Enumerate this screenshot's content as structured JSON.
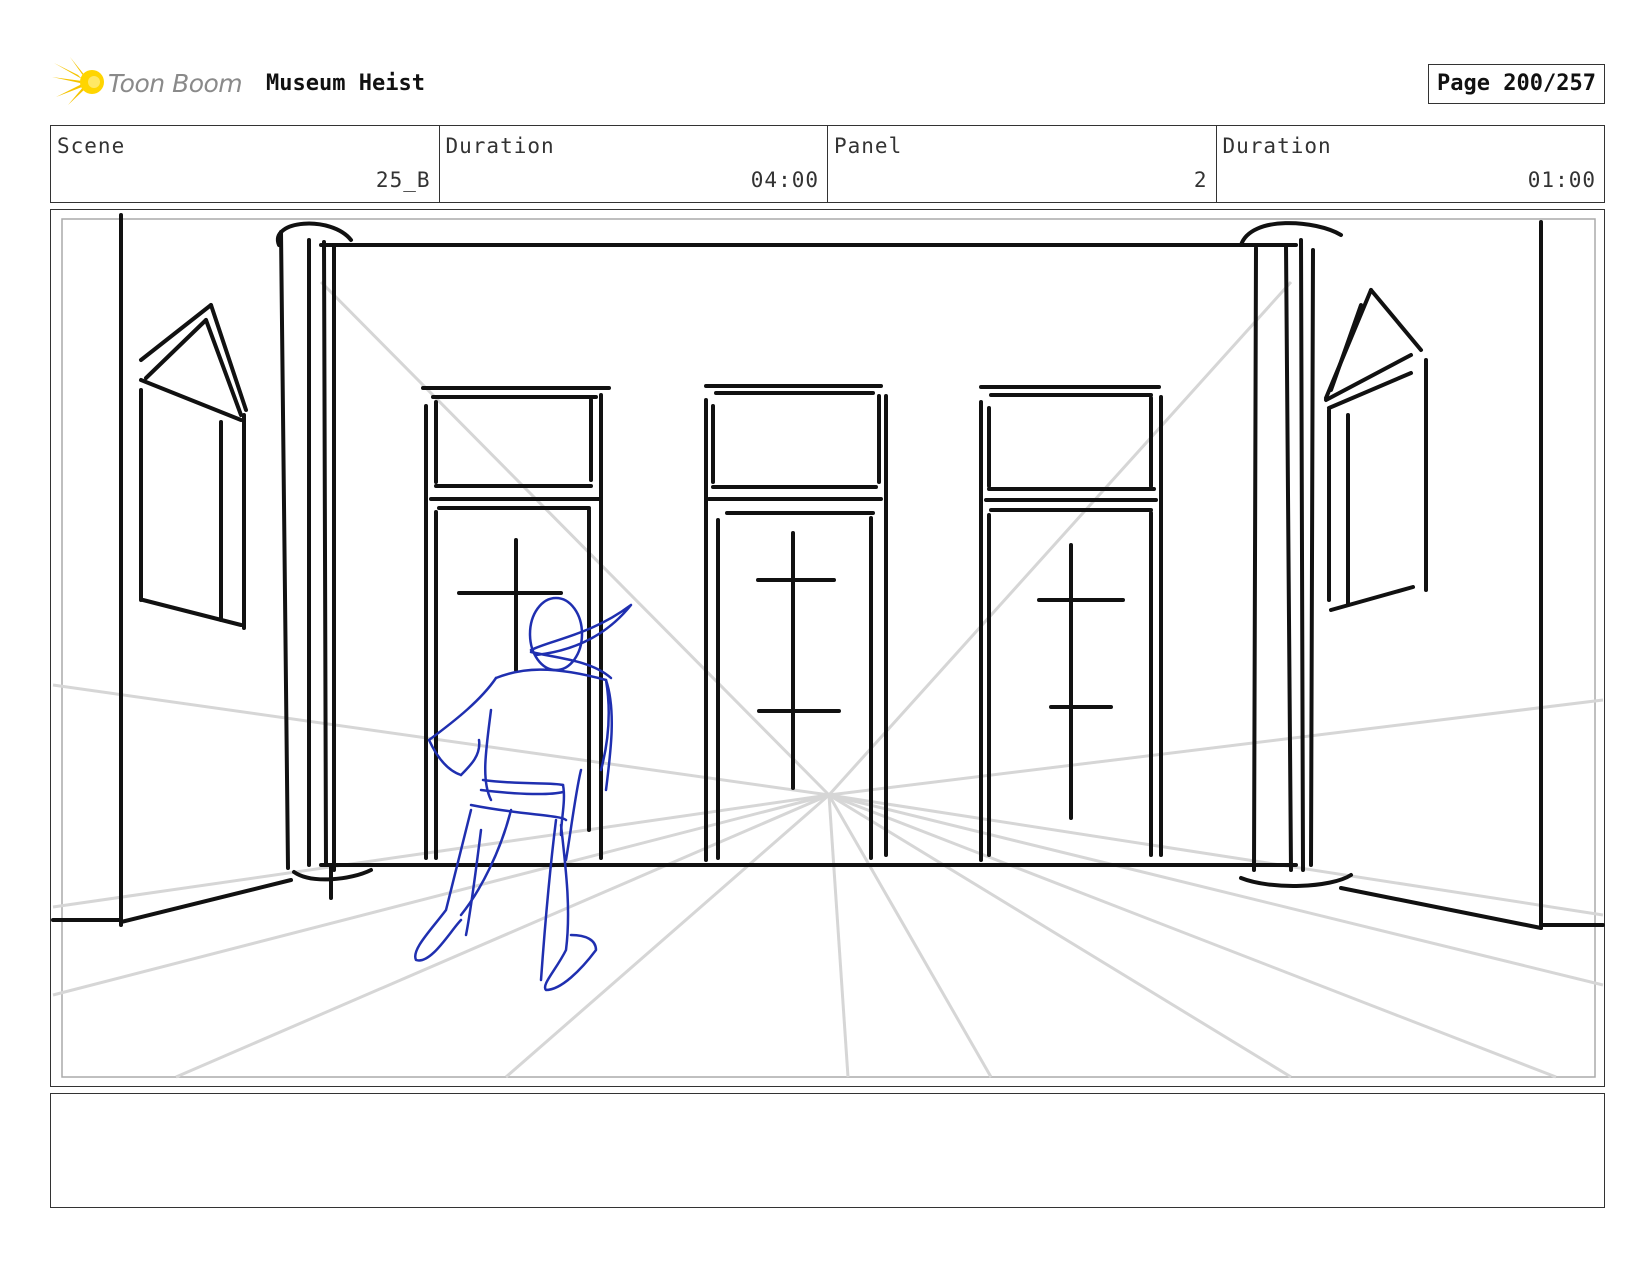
{
  "header": {
    "logo_text": "Toon Boom",
    "project_title": "Museum Heist",
    "page_label": "Page 200/257"
  },
  "info": [
    {
      "label": "Scene",
      "value": "25_B"
    },
    {
      "label": "Duration",
      "value": "04:00"
    },
    {
      "label": "Panel",
      "value": "2"
    },
    {
      "label": "Duration",
      "value": "01:00"
    }
  ],
  "panel": {
    "sketch_color": "#1f2fb0",
    "line_color": "#111111",
    "guide_color": "#d6d6d6"
  },
  "notes": {
    "text": ""
  }
}
